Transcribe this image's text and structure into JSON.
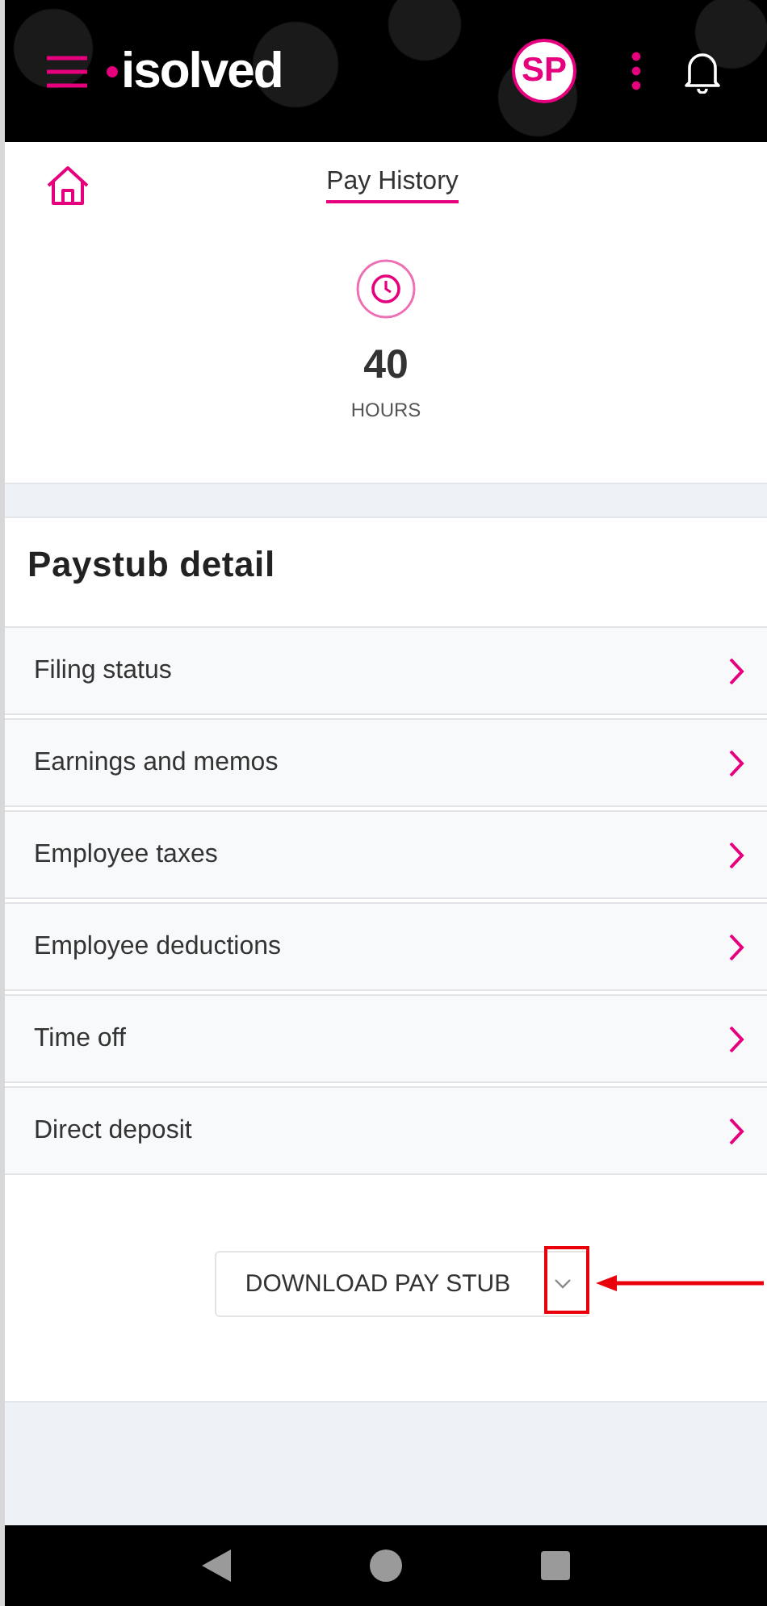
{
  "header": {
    "logo": "isolved",
    "avatar": "SP"
  },
  "nav": {
    "tabs": [
      {
        "label": "Pay History",
        "selected": true
      }
    ]
  },
  "summary": {
    "value": "40",
    "unit": "HOURS"
  },
  "paystub": {
    "title": "Paystub detail",
    "items": [
      {
        "label": "Filing status"
      },
      {
        "label": "Earnings and memos"
      },
      {
        "label": "Employee taxes"
      },
      {
        "label": "Employee deductions"
      },
      {
        "label": "Time off"
      },
      {
        "label": "Direct deposit"
      }
    ],
    "download_button": {
      "label": "DOWNLOAD PAY STUB"
    }
  }
}
